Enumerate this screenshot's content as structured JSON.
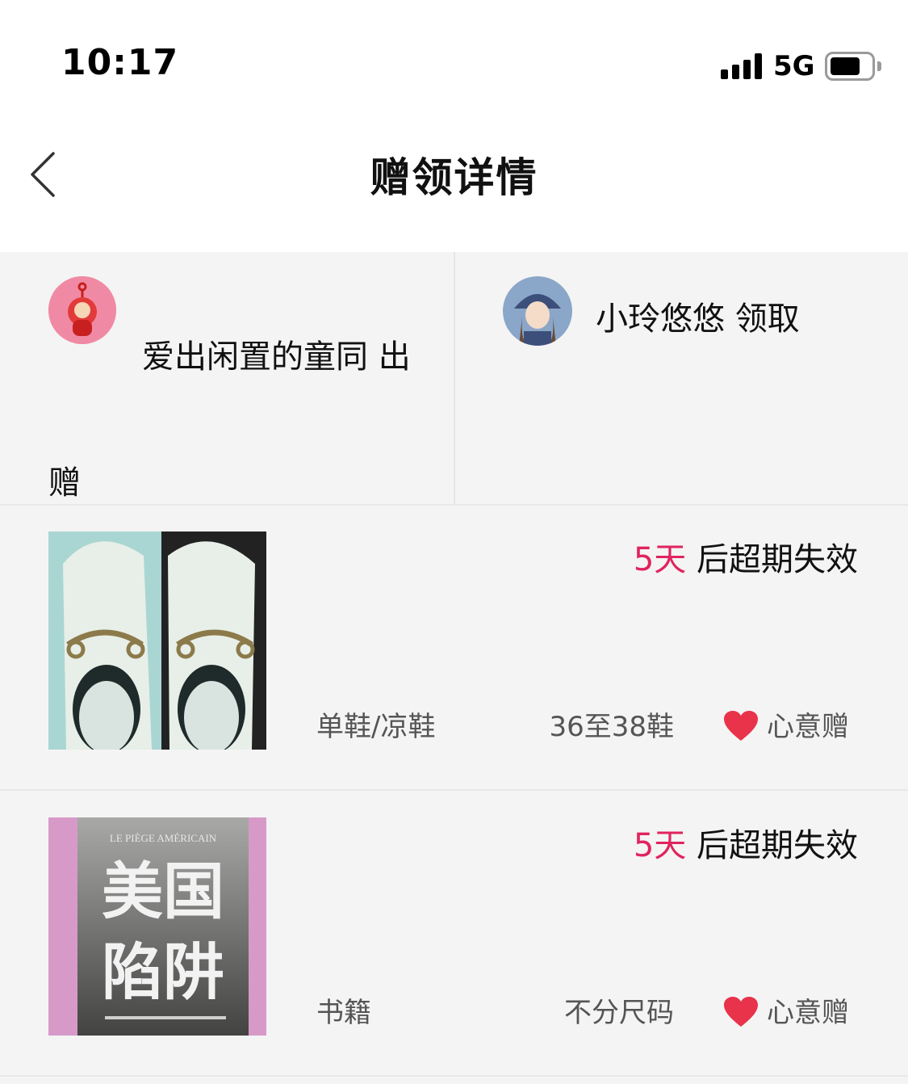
{
  "status_bar": {
    "time": "10:17",
    "network": "5G"
  },
  "nav": {
    "title": "赠领详情"
  },
  "users": {
    "giver_text": "爱出闲置的童同 出赠",
    "receiver_text": "小玲悠悠 领取"
  },
  "items": [
    {
      "expiry_days": "5天",
      "expiry_suffix": " 后超期失效",
      "category": "单鞋/凉鞋",
      "size": "36至38鞋",
      "gift_type": "心意赠",
      "image_icon": "white-loafers"
    },
    {
      "expiry_days": "5天",
      "expiry_suffix": " 后超期失效",
      "category": "书籍",
      "size": "不分尺码",
      "gift_type": "心意赠",
      "image_icon": "book-cover",
      "image_text": {
        "subtitle": "LE PIÈGE AMÉRICAIN",
        "title_line1": "美国",
        "title_line2": "陷阱"
      }
    }
  ],
  "colors": {
    "accent_red": "#e0245e",
    "heart": "#e8334a"
  }
}
